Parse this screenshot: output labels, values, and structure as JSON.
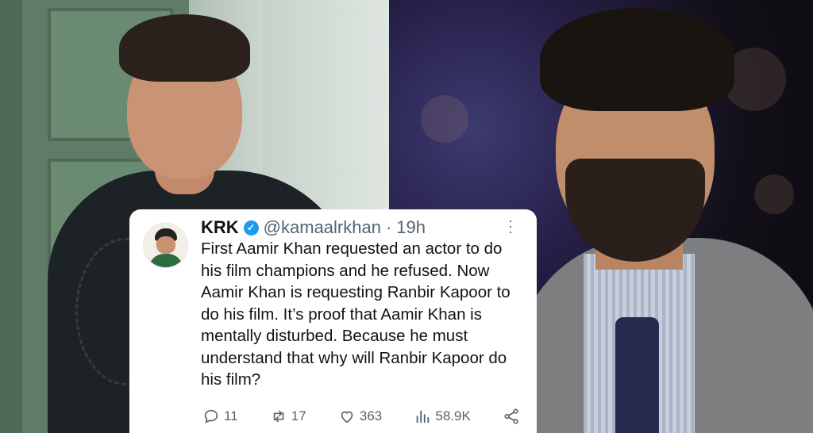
{
  "tweet": {
    "name": "KRK",
    "handle": "@kamaalrkhan",
    "separator": "·",
    "time": "19h",
    "verified_mark": "✓",
    "text": "First Aamir Khan requested an actor to do his film champions and he refused. Now Aamir Khan is requesting Ranbir Kapoor to do his film. It’s proof that Aamir Khan is mentally disturbed. Because he must understand that why will Ranbir Kapoor do his film?",
    "actions": {
      "replies": "11",
      "retweets": "17",
      "likes": "363",
      "views": "58.9K"
    }
  },
  "icons": {
    "more": "more-vertical-icon",
    "reply": "reply-icon",
    "retweet": "retweet-icon",
    "like": "heart-icon",
    "views": "views-icon",
    "share": "share-icon"
  },
  "colors": {
    "verified": "#1d9bf0",
    "muted_text": "#536471",
    "text": "#0f1419",
    "card": "#ffffff"
  }
}
